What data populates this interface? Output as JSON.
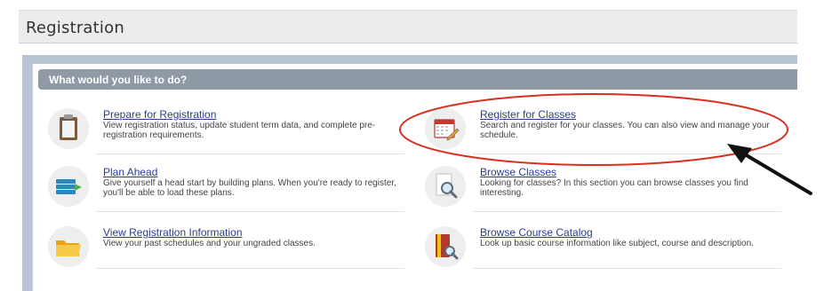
{
  "header": {
    "title": "Registration"
  },
  "panel": {
    "title": "What would you like to do?"
  },
  "items": [
    {
      "link": "Prepare for Registration",
      "description": "View registration status, update student term data, and complete pre-registration requirements.",
      "icon": "clipboard-icon"
    },
    {
      "link": "Register for Classes",
      "description": "Search and register for your classes. You can also view and manage your schedule.",
      "icon": "calendar-edit-icon"
    },
    {
      "link": "Plan Ahead",
      "description": "Give yourself a head start by building plans. When you're ready to register, you'll be able to load these plans.",
      "icon": "stacked-plans-icon"
    },
    {
      "link": "Browse Classes",
      "description": "Looking for classes? In this section you can browse classes you find interesting.",
      "icon": "magnifier-document-icon"
    },
    {
      "link": "View Registration Information",
      "description": "View your past schedules and your ungraded classes.",
      "icon": "folder-icon"
    },
    {
      "link": "Browse Course Catalog",
      "description": "Look up basic course information like subject, course and description.",
      "icon": "catalog-book-icon"
    }
  ],
  "colors": {
    "link": "#2b3c8f",
    "annotation_ellipse": "#d9301f",
    "panel_bar": "#8f9aa6"
  }
}
